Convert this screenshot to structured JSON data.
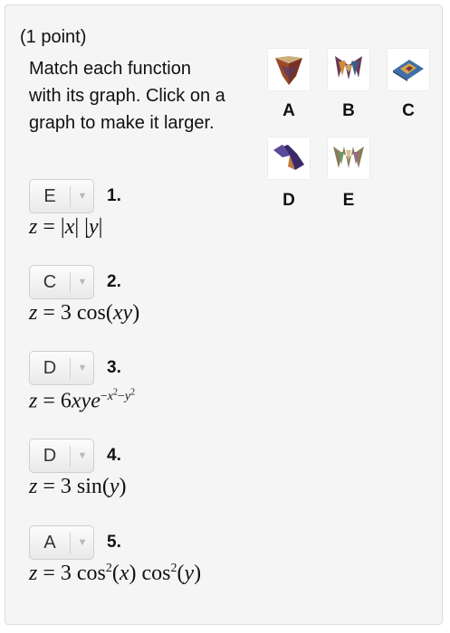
{
  "header": {
    "points": "(1 point)",
    "instructions": "Match each function with its graph. Click on a graph to make it larger."
  },
  "graphs": [
    {
      "label": "A",
      "icon": "surface-plot-a-icon"
    },
    {
      "label": "B",
      "icon": "surface-plot-b-icon"
    },
    {
      "label": "C",
      "icon": "surface-plot-c-icon"
    },
    {
      "label": "D",
      "icon": "surface-plot-d-icon"
    },
    {
      "label": "E",
      "icon": "surface-plot-e-icon"
    }
  ],
  "questions": [
    {
      "number": "1.",
      "selected": "E"
    },
    {
      "number": "2.",
      "selected": "C"
    },
    {
      "number": "3.",
      "selected": "D"
    },
    {
      "number": "4.",
      "selected": "D"
    },
    {
      "number": "5.",
      "selected": "A"
    }
  ],
  "dropdown_arrow": "▼",
  "colors": {
    "panel_bg": "#f5f5f5",
    "panel_border": "#dcdcdc",
    "select_border": "#cfcfcf"
  }
}
